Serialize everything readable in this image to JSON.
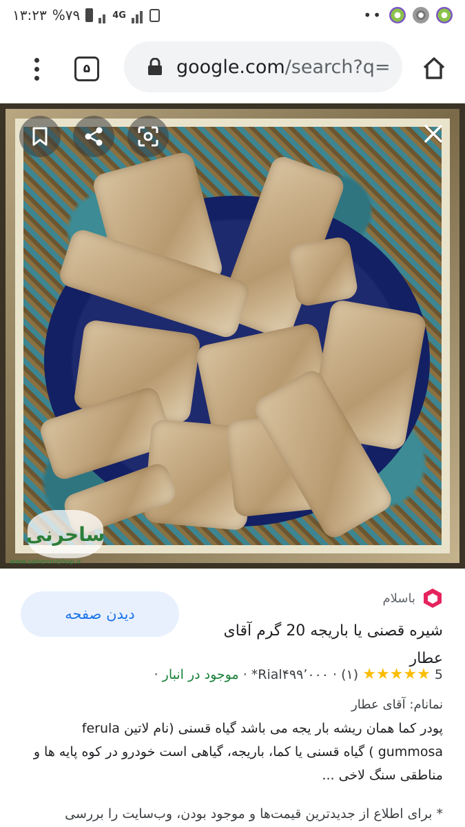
{
  "status": {
    "time": "۱۳:۲۳",
    "battery": "%۷۹",
    "network": "4G",
    "more": "••"
  },
  "toolbar": {
    "tab_count": "۵",
    "url_host": "google.com",
    "url_rest": "/search?q="
  },
  "image": {
    "watermark_text": "ساحرنی",
    "watermark_url": "www.saheronishop.ir"
  },
  "result": {
    "view_page_label": "دیدن صفحه",
    "source_name": "باسلام",
    "title": "شیره قصنی یا باریجه 20 گرم آقای عطار",
    "rating": "5",
    "stars": "★★★★★",
    "review_count": "(۱)",
    "price": "Rial۴۹۹٬۰۰۰*",
    "availability": "موجود در انبار",
    "separator": "·",
    "brand": "نمانام: آقای عطار",
    "description": "پودر کما همان ریشه بار یجه می باشد گیاه قسنی (نام لاتین ferula gummosa ) گیاه قسنی یا کما، باریجه، گیاهی است خودرو در کوه پایه ها و مناطقی سنگ لاخی ...",
    "note": "* برای اطلاع از جدیدترین قیمت‌ها و موجود بودن، وب‌سایت را بررسی"
  },
  "colors": {
    "accent": "#1a73e8",
    "star": "#fbbc04",
    "in_stock": "#188038",
    "source_logo": "#e5245e"
  }
}
